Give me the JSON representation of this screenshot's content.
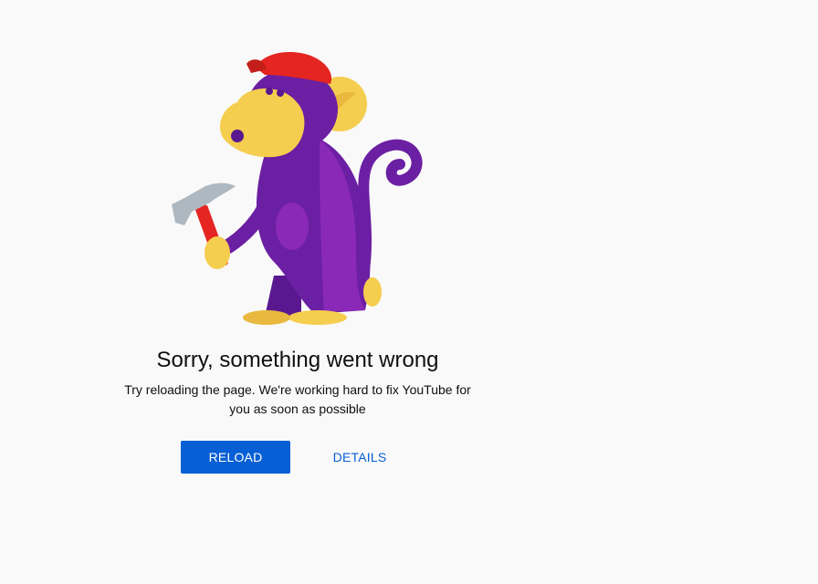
{
  "error": {
    "title": "Sorry, something went wrong",
    "message": "Try reloading the page. We're working hard to fix YouTube for you as soon as possible",
    "illustration": "monkey-with-hammer-illustration"
  },
  "actions": {
    "reload_label": "RELOAD",
    "details_label": "DETAILS"
  },
  "colors": {
    "background": "#f9f9f9",
    "primary": "#065fd4",
    "monkey_purple": "#6b1fa3",
    "monkey_face": "#f5cd4f",
    "cap_red": "#e52521",
    "hammer_head": "#aeb8c0"
  }
}
